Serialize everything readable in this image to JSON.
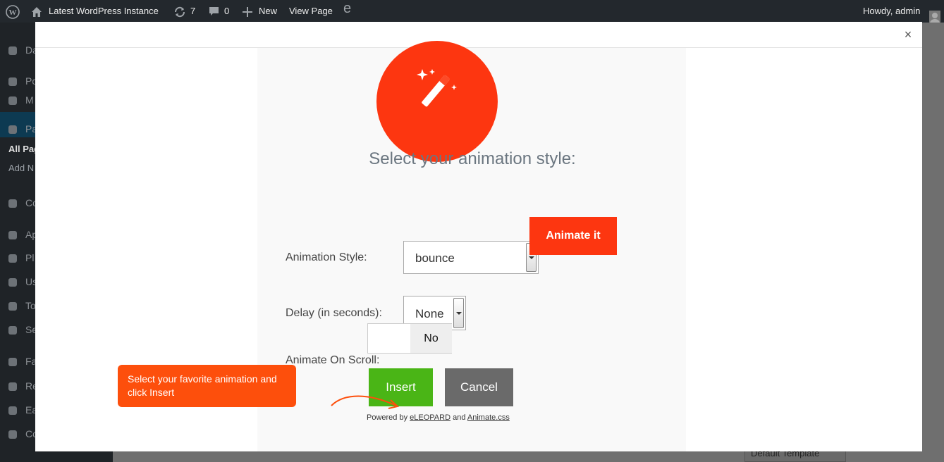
{
  "admin_bar": {
    "site_name": "Latest WordPress Instance",
    "updates_count": "7",
    "comments_count": "0",
    "new_label": "New",
    "view_page_label": "View Page",
    "eleopard_glyph": "e",
    "howdy": "Howdy, admin"
  },
  "admin_menu": {
    "items": [
      {
        "label": "Da",
        "icon": "dashboard-icon"
      },
      {
        "label": "Po",
        "icon": "pin-icon"
      },
      {
        "label": "M",
        "icon": "media-icon"
      },
      {
        "label": "Pa",
        "icon": "pages-icon"
      },
      {
        "label": "Co",
        "icon": "comments-icon"
      },
      {
        "label": "Ap",
        "icon": "brush-icon"
      },
      {
        "label": "Pl",
        "icon": "plugin-icon"
      },
      {
        "label": "Us",
        "icon": "user-icon"
      },
      {
        "label": "To",
        "icon": "wrench-icon"
      },
      {
        "label": "Se",
        "icon": "settings-icon"
      },
      {
        "label": "Fa",
        "icon": "facebook-icon"
      },
      {
        "label": "Re",
        "icon": "eleopard-icon"
      },
      {
        "label": "Ea",
        "icon": "easy-icon"
      },
      {
        "label": "Co",
        "icon": "collapse-icon"
      }
    ],
    "sub_items": [
      "All Pag",
      "Add N"
    ]
  },
  "background": {
    "template_select": "Default Template"
  },
  "modal": {
    "close_label": "×",
    "heading": "Select your animation style:",
    "animation_style_label": "Animation Style:",
    "animation_style_value": "bounce",
    "animate_button": "Animate it",
    "delay_label": "Delay (in seconds):",
    "delay_value": "None",
    "scroll_label": "Animate On Scroll:",
    "scroll_value": "No",
    "insert_button": "Insert",
    "cancel_button": "Cancel",
    "tooltip": "Select your favorite animation and click Insert",
    "powered_prefix": "Powered by",
    "powered_link1": "eLEOPARD",
    "powered_and": "and",
    "powered_link2": "Animate.css"
  },
  "colors": {
    "accent": "#fd3610",
    "insert": "#4ab516",
    "cancel": "#6a6a6a",
    "tooltip": "#fd4f0c",
    "admin_bar": "#23282d"
  }
}
